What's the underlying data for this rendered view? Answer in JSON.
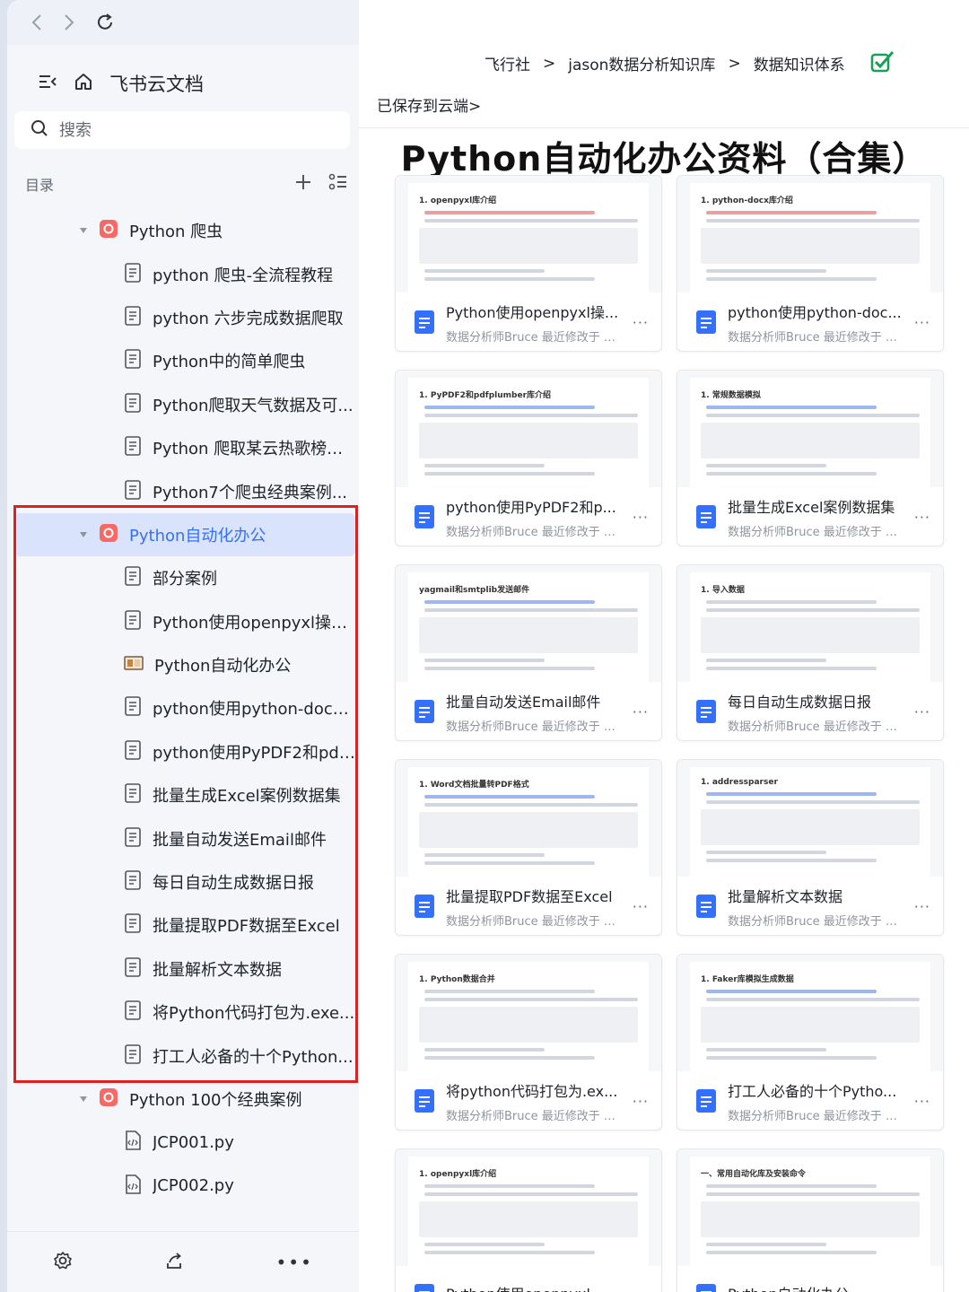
{
  "sidebar": {
    "brand_title": "飞书云文档",
    "search_placeholder": "搜索",
    "toc_label": "目录",
    "tree": [
      {
        "type": "parent",
        "label": "Python 爬虫",
        "icon": "folder-icon"
      },
      {
        "type": "child",
        "label": "python 爬虫-全流程教程",
        "icon": "doc-icon"
      },
      {
        "type": "child",
        "label": "python 六步完成数据爬取",
        "icon": "doc-icon"
      },
      {
        "type": "child",
        "label": "Python中的简单爬虫",
        "icon": "doc-icon"
      },
      {
        "type": "child",
        "label": "Python爬取天气数据及可...",
        "icon": "doc-icon"
      },
      {
        "type": "child",
        "label": "Python 爬取某云热歌榜歌...",
        "icon": "doc-icon"
      },
      {
        "type": "child",
        "label": "Python7个爬虫经典案例...",
        "icon": "doc-icon"
      },
      {
        "type": "parent",
        "label": "Python自动化办公",
        "icon": "folder-icon",
        "active": true
      },
      {
        "type": "child",
        "label": "部分案例",
        "icon": "doc-icon"
      },
      {
        "type": "child",
        "label": "Python使用openpyxl操作...",
        "icon": "doc-icon"
      },
      {
        "type": "child",
        "label": "Python自动化办公",
        "icon": "slide-icon"
      },
      {
        "type": "child",
        "label": "python使用python-docx...",
        "icon": "doc-icon"
      },
      {
        "type": "child",
        "label": "python使用PyPDF2和pdfp...",
        "icon": "doc-icon"
      },
      {
        "type": "child",
        "label": "批量生成Excel案例数据集",
        "icon": "doc-icon"
      },
      {
        "type": "child",
        "label": "批量自动发送Email邮件",
        "icon": "doc-icon"
      },
      {
        "type": "child",
        "label": "每日自动生成数据日报",
        "icon": "doc-icon"
      },
      {
        "type": "child",
        "label": "批量提取PDF数据至Excel",
        "icon": "doc-icon"
      },
      {
        "type": "child",
        "label": "批量解析文本数据",
        "icon": "doc-icon"
      },
      {
        "type": "child",
        "label": "将Python代码打包为.exe...",
        "icon": "doc-icon"
      },
      {
        "type": "child",
        "label": "打工人必备的十个Python...",
        "icon": "doc-icon"
      },
      {
        "type": "parent",
        "label": "Python 100个经典案例",
        "icon": "folder-icon"
      },
      {
        "type": "child",
        "label": "JCP001.py",
        "icon": "file-icon"
      },
      {
        "type": "child",
        "label": "JCP002.py",
        "icon": "file-icon"
      }
    ]
  },
  "main": {
    "breadcrumbs": [
      "飞行社",
      "jason数据分析知识库",
      "数据知识体系"
    ],
    "breadcrumb_sep": ">",
    "saved_status": "已保存到云端>",
    "title": "Python自动化办公资料（合集）",
    "cards": [
      {
        "title": "Python使用openpyxl操...",
        "meta": "数据分析师Bruce 最近修改于 今...",
        "preview_heading": "1. openpyxl库介绍",
        "accent": "red"
      },
      {
        "title": "python使用python-doc...",
        "meta": "数据分析师Bruce 最近修改于 今...",
        "preview_heading": "1. python-docx库介绍",
        "accent": "red"
      },
      {
        "title": "python使用PyPDF2和p...",
        "meta": "数据分析师Bruce 最近修改于 今...",
        "preview_heading": "1. PyPDF2和pdfplumber库介绍",
        "accent": "blue"
      },
      {
        "title": "批量生成Excel案例数据集",
        "meta": "数据分析师Bruce 最近修改于 今...",
        "preview_heading": "1. 常规数据模拟",
        "accent": "blue"
      },
      {
        "title": "批量自动发送Email邮件",
        "meta": "数据分析师Bruce 最近修改于 今...",
        "preview_heading": "yagmail和smtplib发送邮件",
        "accent": "blue"
      },
      {
        "title": "每日自动生成数据日报",
        "meta": "数据分析师Bruce 最近修改于 今...",
        "preview_heading": "1. 导入数据",
        "accent": "gray"
      },
      {
        "title": "批量提取PDF数据至Excel",
        "meta": "数据分析师Bruce 最近修改于 今...",
        "preview_heading": "1. Word文档批量转PDF格式",
        "accent": "blue"
      },
      {
        "title": "批量解析文本数据",
        "meta": "数据分析师Bruce 最近修改于 今...",
        "preview_heading": "1. addressparser",
        "accent": "blue"
      },
      {
        "title": "将python代码打包为.ex...",
        "meta": "数据分析师Bruce 最近修改于 今...",
        "preview_heading": "1. Python数据合并",
        "accent": "gray"
      },
      {
        "title": "打工人必备的十个Pytho...",
        "meta": "数据分析师Bruce 最近修改于 今...",
        "preview_heading": "1. Faker库模拟生成数据",
        "accent": "blue"
      },
      {
        "title": "Python使用openpyxl...",
        "meta": "",
        "preview_heading": "1. openpyxl库介绍",
        "accent": "gray"
      },
      {
        "title": "Python自动化办公",
        "meta": "",
        "preview_heading": "一、常用自动化库及安装命令",
        "accent": "gray"
      }
    ]
  },
  "colors": {
    "accent": "#3370ff",
    "highlight_box": "#e02020",
    "active_row": "#d9e3fb",
    "doc_icon": "#3370ff",
    "folder_icon": "#f76964"
  }
}
